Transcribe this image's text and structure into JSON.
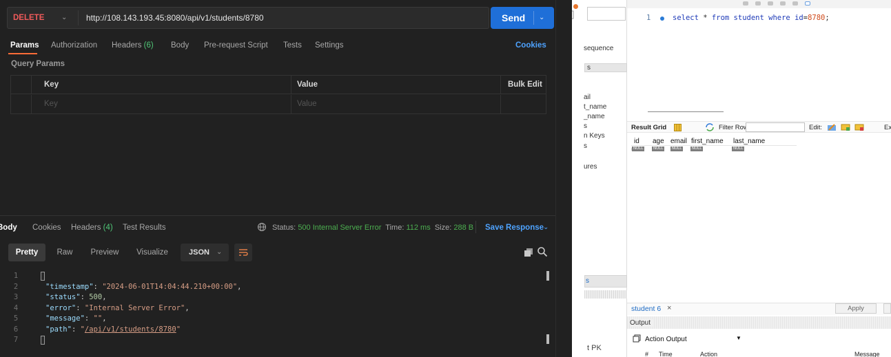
{
  "postman": {
    "request": {
      "method": "DELETE",
      "url": "http://108.143.193.45:8080/api/v1/students/8780",
      "send_label": "Send"
    },
    "request_tabs": [
      {
        "label": "Params"
      },
      {
        "label": "Authorization"
      },
      {
        "label": "Headers",
        "count": "(6)"
      },
      {
        "label": "Body"
      },
      {
        "label": "Pre-request Script"
      },
      {
        "label": "Tests"
      },
      {
        "label": "Settings"
      }
    ],
    "cookies_label": "Cookies",
    "query_params_label": "Query Params",
    "params_table": {
      "headers": [
        "Key",
        "Value",
        "Bulk Edit"
      ],
      "placeholder_key": "Key",
      "placeholder_value": "Value"
    },
    "response_tabs": [
      {
        "label": "Body"
      },
      {
        "label": "Cookies"
      },
      {
        "label": "Headers",
        "count": "(4)"
      },
      {
        "label": "Test Results"
      }
    ],
    "response_status": {
      "status_label": "Status:",
      "status_value": "500 Internal Server Error",
      "time_label": "Time:",
      "time_value": "112 ms",
      "size_label": "Size:",
      "size_value": "288 B"
    },
    "save_response_label": "Save Response",
    "view_tabs": [
      "Pretty",
      "Raw",
      "Preview",
      "Visualize"
    ],
    "format_select": "JSON",
    "response_body": {
      "line_numbers": [
        "1",
        "2",
        "3",
        "4",
        "5",
        "6",
        "7"
      ],
      "timestamp_key": "\"timestamp\"",
      "timestamp_value": "\"2024-06-01T14:04:44.210+00:00\"",
      "status_key": "\"status\"",
      "status_value": "500",
      "error_key": "\"error\"",
      "error_value": "\"Internal Server Error\"",
      "message_key": "\"message\"",
      "message_value": "\"\"",
      "path_key": "\"path\"",
      "path_value": "/api/v1/students/8780"
    },
    "colors": {
      "method_delete": "#f05a5a",
      "send_button": "#1f6fd8",
      "status_error": "#4caf50",
      "link": "#4ea3ff",
      "active_tab_underline": "#ff6c37"
    }
  },
  "workbench": {
    "navigator_fragments": [
      "sequence",
      "s",
      "ail",
      "t_name",
      "_name",
      "s",
      "n Keys",
      "s",
      "ures",
      "s",
      "t PK"
    ],
    "sql_line_number": "1",
    "sql": {
      "kw_select": "select",
      "star": "*",
      "kw_from": "from",
      "table": "student",
      "kw_where": "where",
      "cond_col": "id",
      "eq": "=",
      "cond_val": "8780",
      "semicolon": ";"
    },
    "result_toolbar": {
      "result_grid": "Result Grid",
      "filter_rows": "Filter Rows:",
      "edit": "Edit:",
      "export": "Exp"
    },
    "result_grid": {
      "columns": [
        "id",
        "age",
        "email",
        "first_name",
        "last_name"
      ],
      "null_label": "NULL",
      "row_marker": "*"
    },
    "result_tab": "student 6",
    "apply_label": "Apply",
    "output": {
      "label": "Output",
      "selector": "Action Output",
      "headers": [
        "#",
        "Time",
        "Action",
        "Message"
      ]
    }
  }
}
